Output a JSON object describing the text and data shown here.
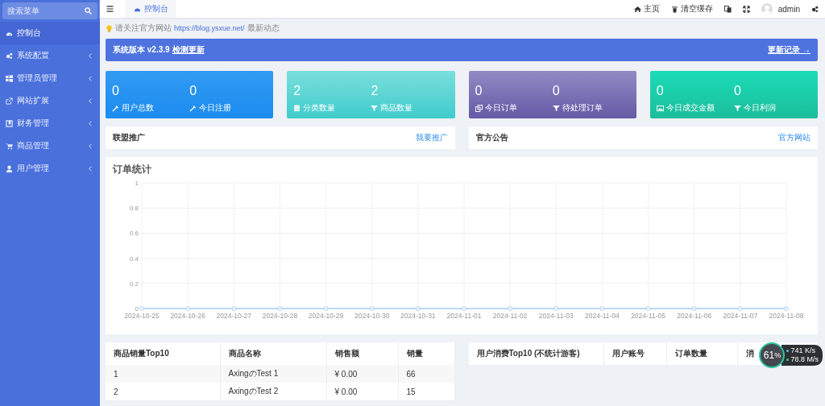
{
  "sidebar": {
    "search": {
      "placeholder": "搜索菜单"
    },
    "items": [
      {
        "label": "控制台",
        "selected": true,
        "has_submenu": false
      },
      {
        "label": "系统配置",
        "selected": false,
        "has_submenu": true
      },
      {
        "label": "管理员管理",
        "selected": false,
        "has_submenu": true
      },
      {
        "label": "网站扩展",
        "selected": false,
        "has_submenu": true
      },
      {
        "label": "财务管理",
        "selected": false,
        "has_submenu": true
      },
      {
        "label": "商品管理",
        "selected": false,
        "has_submenu": true
      },
      {
        "label": "用户管理",
        "selected": false,
        "has_submenu": true
      }
    ]
  },
  "topbar": {
    "tabs": [
      {
        "label": "控制台",
        "selected": true
      }
    ],
    "actions": [
      {
        "kind": "link",
        "label": "主页"
      },
      {
        "kind": "link",
        "label": "清空缓存"
      },
      {
        "kind": "icon"
      },
      {
        "kind": "icon"
      },
      {
        "kind": "user",
        "label": "admin"
      },
      {
        "kind": "icon"
      }
    ]
  },
  "notice": {
    "before": "请关注官方网站",
    "link": "https://blog.ysxue.net/",
    "after": "最新动态"
  },
  "version_banner": {
    "text": "系统版本 v2.3.9",
    "check_link": "检测更新",
    "log_link": "更新记录 →"
  },
  "stat_cards": [
    {
      "stats": [
        {
          "value": "0",
          "label": "用户总数"
        },
        {
          "value": "0",
          "label": "今日注册"
        }
      ]
    },
    {
      "stats": [
        {
          "value": "2",
          "label": "分类数量"
        },
        {
          "value": "2",
          "label": "商品数量"
        }
      ]
    },
    {
      "stats": [
        {
          "value": "0",
          "label": "今日订单"
        },
        {
          "value": "0",
          "label": "待处理订单"
        }
      ]
    },
    {
      "stats": [
        {
          "value": "0",
          "label": "今日成交金额"
        },
        {
          "value": "0",
          "label": "今日利润"
        }
      ]
    }
  ],
  "info_cards": [
    {
      "title": "联盟推广",
      "link": "我要推广"
    },
    {
      "title": "官方公告",
      "link": "官方网站"
    }
  ],
  "order_chart": {
    "title": "订单统计",
    "chart_data": {
      "type": "line",
      "grid": true,
      "categories": [
        "2024-10-25",
        "2024-10-26",
        "2024-10-27",
        "2024-10-28",
        "2024-10-29",
        "2024-10-30",
        "2024-10-31",
        "2024-11-01",
        "2024-11-02",
        "2024-11-03",
        "2024-11-04",
        "2024-11-05",
        "2024-11-06",
        "2024-11-07",
        "2024-11-08"
      ],
      "series": [
        {
          "color": "#a8cdf5",
          "marker": "circle",
          "values": [
            0,
            0,
            0,
            0,
            0,
            0,
            0,
            0,
            0,
            0,
            0,
            0,
            0,
            0,
            0
          ]
        }
      ],
      "ylim": [
        0,
        1
      ],
      "yticks": [
        0,
        0.2,
        0.4,
        0.6,
        0.8,
        1
      ]
    }
  },
  "tables": [
    {
      "columns": [
        "商品销量Top10",
        "商品名称",
        "销售额",
        "销量"
      ],
      "rows": [
        [
          "1",
          "AxingのTest 1",
          "¥ 0.00",
          "66"
        ],
        [
          "2",
          "AxingのTest 2",
          "¥ 0.00",
          "15"
        ]
      ]
    },
    {
      "columns": [
        "用户消费Top10 (不统计游客)",
        "用户账号",
        "订单数量",
        "消"
      ]
    }
  ],
  "speed_widget": {
    "percent": "61",
    "percent_unit": "%",
    "upload": "741",
    "upload_unit": "K/s",
    "download": "78.8",
    "download_unit": "M/s"
  }
}
